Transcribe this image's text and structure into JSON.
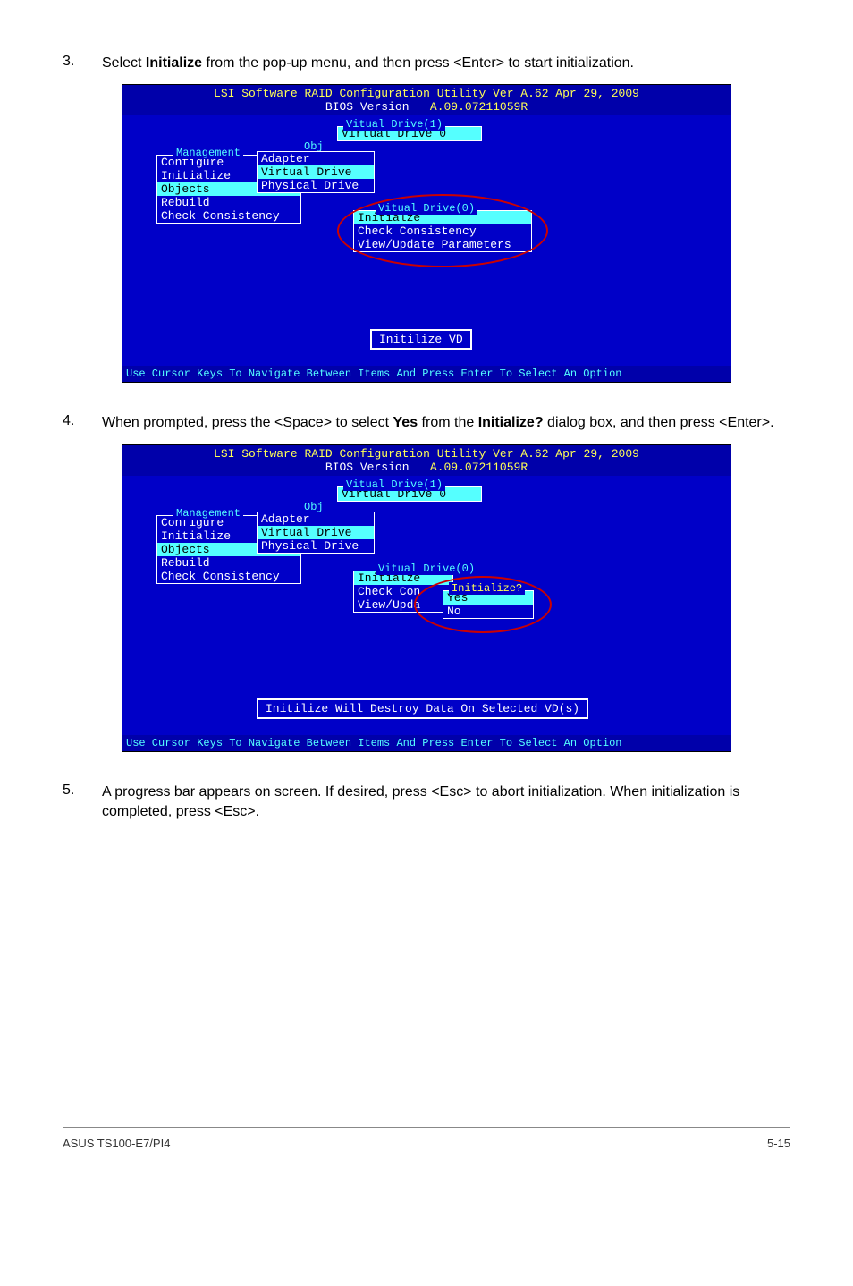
{
  "steps": {
    "s3": {
      "num": "3.",
      "text_a": "Select ",
      "bold_a": "Initialize",
      "text_b": " from the pop-up menu, and then press <Enter> to start initialization."
    },
    "s4": {
      "num": "4.",
      "text_a": "When prompted, press the <Space> to select ",
      "bold_a": "Yes",
      "text_b": " from the ",
      "bold_b": "Initialize?",
      "text_c": " dialog box, and then press <Enter>."
    },
    "s5": {
      "num": "5.",
      "text_a": "A progress bar appears on screen. If desired, press <Esc> to abort initialization. When initialization is completed, press <Esc>."
    }
  },
  "bios": {
    "title_a": "LSI Software RAID Configuration Utility Ver A.62 Apr 29, 2009",
    "title_b": "BIOS Version   A.09.07211059R",
    "vd1_label": "Vitual Drive(1)",
    "vd1_item": "Virtual Drive 0",
    "obj_label": "Obj",
    "mgmt_label": "Management",
    "menu": {
      "configure": "Configure",
      "initialize": "Initialize",
      "objects": "Objects",
      "rebuild": "Rebuild",
      "check": "Check Consistency"
    },
    "obj_menu": {
      "adapter": "Adapter",
      "vdrive": "Virtual Drive",
      "pdrive": "Physical Drive"
    },
    "vd0_label": "Vitual Drive(0)",
    "vd0_items": {
      "init": "Initialze",
      "check": "Check Consistency",
      "view": "View/Update Parameters"
    },
    "vd0_items_b": {
      "init": "Initialze",
      "check": "Check Con",
      "view": "View/Upda"
    },
    "init_label": "Initialize?",
    "yes": "Yes",
    "no": "No",
    "status1": "Initilize VD",
    "status2": "Initilize Will Destroy Data On Selected VD(s)",
    "footer": "Use Cursor Keys To Navigate Between Items And Press Enter To Select An Option"
  },
  "footer": {
    "left": "ASUS TS100-E7/PI4",
    "right": "5-15"
  }
}
